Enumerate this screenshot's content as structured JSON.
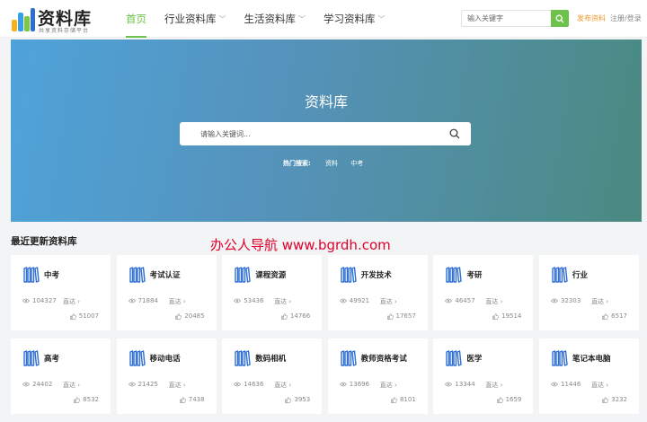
{
  "brand": {
    "title": "资料库",
    "subtitle": "共享资料存储平台",
    "colors": {
      "accent": "#6cc24a",
      "publish": "#f29a2e",
      "watermark": "#e0002a"
    }
  },
  "nav": {
    "items": [
      {
        "label": "首页",
        "active": true,
        "dropdown": false
      },
      {
        "label": "行业资料库",
        "active": false,
        "dropdown": true
      },
      {
        "label": "生活资料库",
        "active": false,
        "dropdown": true
      },
      {
        "label": "学习资料库",
        "active": false,
        "dropdown": true
      }
    ]
  },
  "header_search": {
    "placeholder": "输入关键字",
    "icon": "search-icon"
  },
  "header_actions": {
    "publish": "发布资料",
    "login": "注册",
    "separator": "/",
    "register": "登录"
  },
  "hero": {
    "title": "资料库",
    "search_placeholder": "请输入关键词...",
    "hot_label": "热门搜索:",
    "hot_keywords": [
      "资料",
      "中考"
    ]
  },
  "section": {
    "title": "最近更新资料库"
  },
  "watermark": "办公人导航  www.bgrdh.com",
  "cards": [
    {
      "name": "中考",
      "views": "104327",
      "go": "直达",
      "likes": "51007"
    },
    {
      "name": "考试认证",
      "views": "71884",
      "go": "直达",
      "likes": "20485"
    },
    {
      "name": "课程资源",
      "views": "53436",
      "go": "直达",
      "likes": "14766"
    },
    {
      "name": "开发技术",
      "views": "49921",
      "go": "直达",
      "likes": "17657"
    },
    {
      "name": "考研",
      "views": "46457",
      "go": "直达",
      "likes": "19514"
    },
    {
      "name": "行业",
      "views": "32303",
      "go": "直达",
      "likes": "6517"
    },
    {
      "name": "高考",
      "views": "24402",
      "go": "直达",
      "likes": "8532"
    },
    {
      "name": "移动电话",
      "views": "21425",
      "go": "直达",
      "likes": "7438"
    },
    {
      "name": "数码相机",
      "views": "14636",
      "go": "直达",
      "likes": "3953"
    },
    {
      "name": "教师资格考试",
      "views": "13696",
      "go": "直达",
      "likes": "8101"
    },
    {
      "name": "医学",
      "views": "13344",
      "go": "直达",
      "likes": "1659"
    },
    {
      "name": "笔记本电脑",
      "views": "11446",
      "go": "直达",
      "likes": "3232"
    }
  ]
}
